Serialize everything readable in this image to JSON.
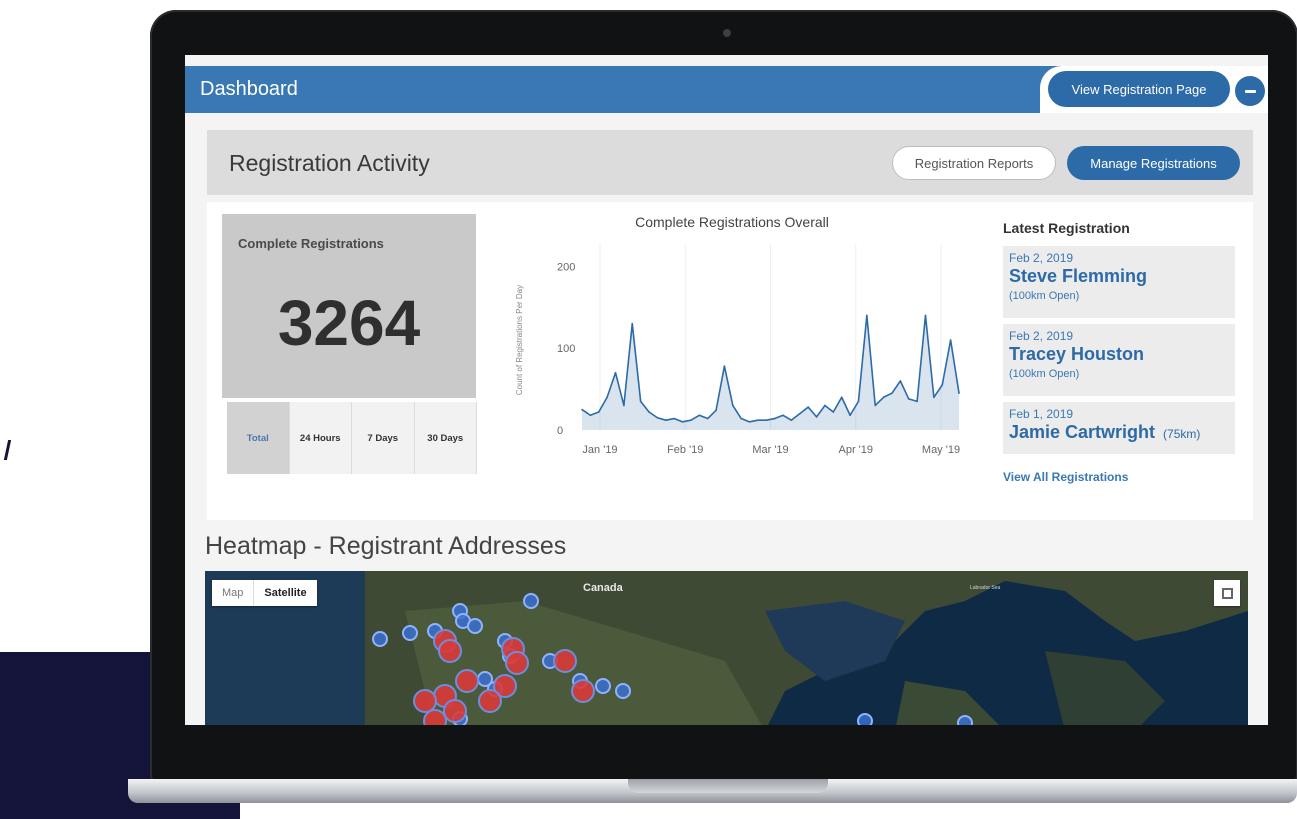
{
  "header": {
    "title": "Dashboard",
    "view_registration_label": "View Registration Page",
    "collapse_icon": "minus-icon"
  },
  "activity": {
    "title": "Registration Activity",
    "reports_label": "Registration Reports",
    "manage_label": "Manage Registrations"
  },
  "stats": {
    "label": "Complete Registrations",
    "value": "3264",
    "periods": [
      "Total",
      "24 Hours",
      "7 Days",
      "30 Days"
    ],
    "active_period": "Total"
  },
  "chart_data": {
    "type": "line",
    "title": "Complete Registrations Overall",
    "ylabel": "Count of Registrations Per Day",
    "xlabel": "",
    "ylim": [
      0,
      220
    ],
    "yticks": [
      0,
      100,
      200
    ],
    "xticks": [
      "Jan '19",
      "Feb '19",
      "Mar '19",
      "Apr '19",
      "May '19"
    ],
    "x": [
      "Jan '19",
      "",
      "",
      "",
      "",
      "",
      "",
      "",
      "",
      "",
      "Feb '19",
      "",
      "",
      "",
      "",
      "",
      "",
      "",
      "",
      "",
      "Mar '19",
      "",
      "",
      "",
      "",
      "",
      "",
      "",
      "",
      "",
      "Apr '19",
      "",
      "",
      "",
      "",
      "",
      "",
      "",
      "",
      "",
      "May '19",
      "",
      "",
      "",
      "",
      ""
    ],
    "series": [
      {
        "values": [
          25,
          18,
          22,
          40,
          70,
          30,
          130,
          35,
          22,
          15,
          12,
          14,
          10,
          12,
          18,
          14,
          24,
          78,
          30,
          14,
          10,
          12,
          12,
          14,
          18,
          12,
          20,
          28,
          16,
          30,
          22,
          40,
          18,
          35,
          140,
          30,
          40,
          45,
          60,
          38,
          35,
          140,
          40,
          55,
          110,
          45
        ],
        "color": "#2c6aa8"
      }
    ],
    "grid": true
  },
  "latest": {
    "title": "Latest Registration",
    "items": [
      {
        "date": "Feb 2, 2019",
        "name": "Steve Flemming",
        "race": "(100km Open)"
      },
      {
        "date": "Feb 2, 2019",
        "name": "Tracey Houston",
        "race": "(100km Open)"
      },
      {
        "date": "Feb 1, 2019",
        "name": "Jamie Cartwright",
        "race": "(75km)"
      }
    ],
    "view_all_label": "View All Registrations"
  },
  "heatmap": {
    "title": "Heatmap - Registrant Addresses",
    "map_label": "Map",
    "satellite_label": "Satellite",
    "region_label": "Canada",
    "sea_label": "Labrador Sea",
    "fullscreen_icon": "fullscreen-icon",
    "marker_color": "#d93a3a",
    "ring_color": "#3a6fd0"
  }
}
